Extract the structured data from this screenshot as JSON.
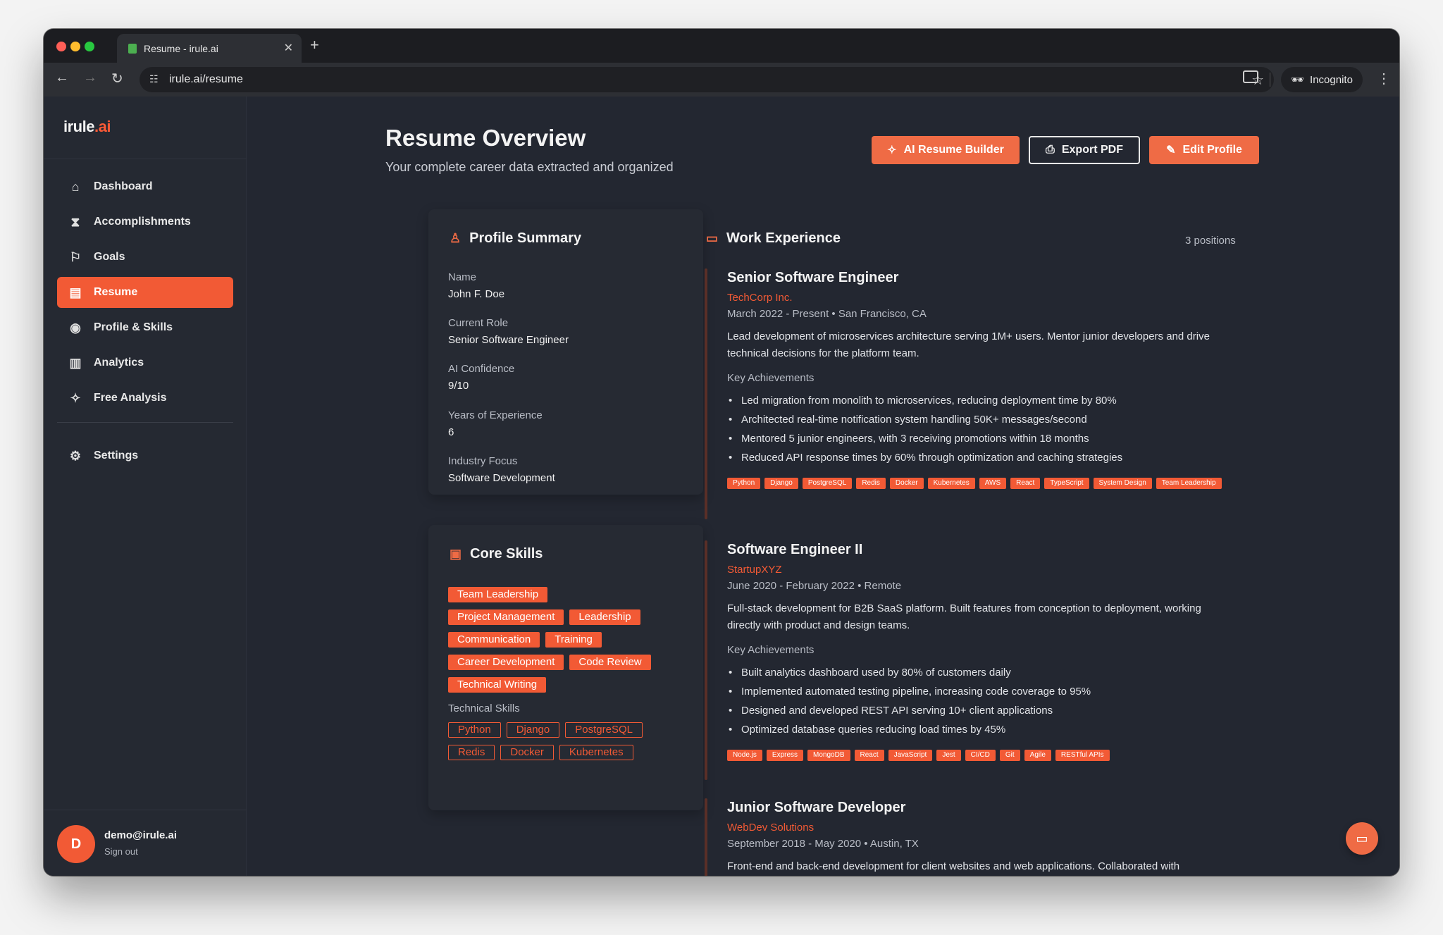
{
  "browser": {
    "tab_title": "Resume - irule.ai",
    "url": "irule.ai/resume",
    "incognito_label": "Incognito"
  },
  "sidebar": {
    "logo_main": "irule",
    "logo_accent": ".ai",
    "items": [
      {
        "label": "Dashboard",
        "icon": "home-icon"
      },
      {
        "label": "Accomplishments",
        "icon": "hourglass-icon"
      },
      {
        "label": "Goals",
        "icon": "flag-icon"
      },
      {
        "label": "Resume",
        "icon": "document-icon"
      },
      {
        "label": "Profile & Skills",
        "icon": "user-circle-icon"
      },
      {
        "label": "Analytics",
        "icon": "bar-chart-icon"
      },
      {
        "label": "Free Analysis",
        "icon": "sparkle-icon"
      }
    ],
    "settings_label": "Settings",
    "user_initial": "D",
    "user_email": "demo@irule.ai",
    "sign_out": "Sign out"
  },
  "header": {
    "title": "Resume Overview",
    "subtitle": "Your complete career data extracted and organized",
    "ai_builder": "AI Resume Builder",
    "export_pdf": "Export PDF",
    "edit_profile": "Edit Profile"
  },
  "profile": {
    "title": "Profile Summary",
    "fields": [
      {
        "label": "Name",
        "value": "John F. Doe"
      },
      {
        "label": "Current Role",
        "value": "Senior Software Engineer"
      },
      {
        "label": "AI Confidence",
        "value": "9/10"
      },
      {
        "label": "Years of Experience",
        "value": "6"
      },
      {
        "label": "Industry Focus",
        "value": "Software Development"
      }
    ]
  },
  "skills": {
    "title": "Core Skills",
    "core": [
      "Team Leadership",
      "Project Management",
      "Leadership",
      "Communication",
      "Training",
      "Career Development",
      "Code Review",
      "Technical Writing"
    ],
    "technical_label": "Technical Skills",
    "technical": [
      "Python",
      "Django",
      "PostgreSQL",
      "Redis",
      "Docker",
      "Kubernetes"
    ]
  },
  "work": {
    "title": "Work Experience",
    "count": "3 positions",
    "key_label": "Key Achievements",
    "jobs": [
      {
        "title": "Senior Software Engineer",
        "company": "TechCorp Inc.",
        "meta": "March 2022 - Present • San Francisco, CA",
        "desc": "Lead development of microservices architecture serving 1M+ users. Mentor junior developers and drive technical decisions for the platform team.",
        "achievements": [
          "Led migration from monolith to microservices, reducing deployment time by 80%",
          "Architected real-time notification system handling 50K+ messages/second",
          "Mentored 5 junior engineers, with 3 receiving promotions within 18 months",
          "Reduced API response times by 60% through optimization and caching strategies"
        ],
        "tags": [
          "Python",
          "Django",
          "PostgreSQL",
          "Redis",
          "Docker",
          "Kubernetes",
          "AWS",
          "React",
          "TypeScript",
          "System Design",
          "Team Leadership"
        ]
      },
      {
        "title": "Software Engineer II",
        "company": "StartupXYZ",
        "meta": "June 2020 - February 2022 • Remote",
        "desc": "Full-stack development for B2B SaaS platform. Built features from conception to deployment, working directly with product and design teams.",
        "achievements": [
          "Built analytics dashboard used by 80% of customers daily",
          "Implemented automated testing pipeline, increasing code coverage to 95%",
          "Designed and developed REST API serving 10+ client applications",
          "Optimized database queries reducing load times by 45%"
        ],
        "tags": [
          "Node.js",
          "Express",
          "MongoDB",
          "React",
          "JavaScript",
          "Jest",
          "CI/CD",
          "Git",
          "Agile",
          "RESTful APIs"
        ]
      },
      {
        "title": "Junior Software Developer",
        "company": "WebDev Solutions",
        "meta": "September 2018 - May 2020 • Austin, TX",
        "desc": "Front-end and back-end development for client websites and web applications. Collaborated with",
        "achievements": [],
        "tags": []
      }
    ]
  },
  "colors": {
    "accent": "#f25a35",
    "bg": "#232731",
    "sidebar": "#252932"
  }
}
